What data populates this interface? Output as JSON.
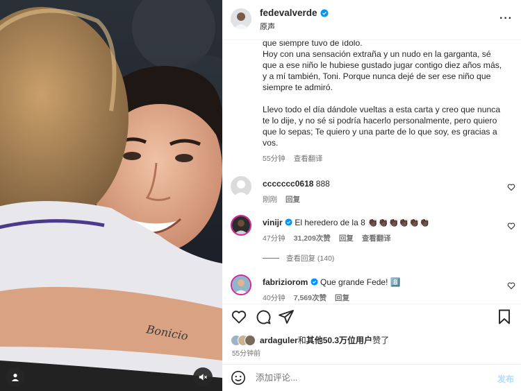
{
  "post": {
    "username": "fedevalverde",
    "audio_label": "原声",
    "more_label": "···",
    "caption_paragraphs": [
      "que siempre tuvo de ídolo.\nHoy con una sensación extraña y un nudo en la garganta, sé que a ese niño le hubiese gustado jugar contigo diez años más, y a mí también, Toni. Porque nunca dejé de ser ese niño que siempre te admiró.",
      "Llevo todo el día dándole vueltas a esta carta y creo que nunca te lo dije, y no sé si podría hacerlo personalmente, pero quiero que lo sepas; Te quiero y una parte de lo que soy, es gracias a vos."
    ],
    "caption_time": "55分钟",
    "caption_translate": "查看翻译"
  },
  "comments": [
    {
      "user": "ccccccc0618",
      "text": "888",
      "time": "刚刚",
      "reply": "回复",
      "likes": "",
      "translate": ""
    },
    {
      "user": "vinijr",
      "text": "El heredero de la 8 👏🏿👏🏿👏🏿👏🏿👏🏿👏🏿",
      "time": "47分钟",
      "likes": "31,209次赞",
      "reply": "回复",
      "translate": "查看翻译"
    },
    {
      "user": "fabriziorom",
      "text": "Que grande Fede! 8️⃣",
      "time": "40分钟",
      "likes": "7,569次赞",
      "reply": "回复",
      "translate": ""
    }
  ],
  "view_replies": "查看回复 (140)",
  "likes_summary": {
    "user": "ardaguler",
    "conj": "和",
    "others": "其他50.3万位用户",
    "suffix": "赞了"
  },
  "post_time": "55分钟前",
  "add_comment": {
    "placeholder": "添加评论...",
    "post_label": "发布"
  },
  "colors": {
    "verified": "#0095f6",
    "secondary_text": "#737373",
    "post_button_disabled": "#b3dbff",
    "photo_background": "#1b2027"
  },
  "icons": {
    "like": "heart-icon",
    "comment": "comment-icon",
    "share": "share-icon",
    "save": "bookmark-icon",
    "emoji": "emoji-icon",
    "tag": "user-tag-icon",
    "mute": "mute-icon"
  }
}
